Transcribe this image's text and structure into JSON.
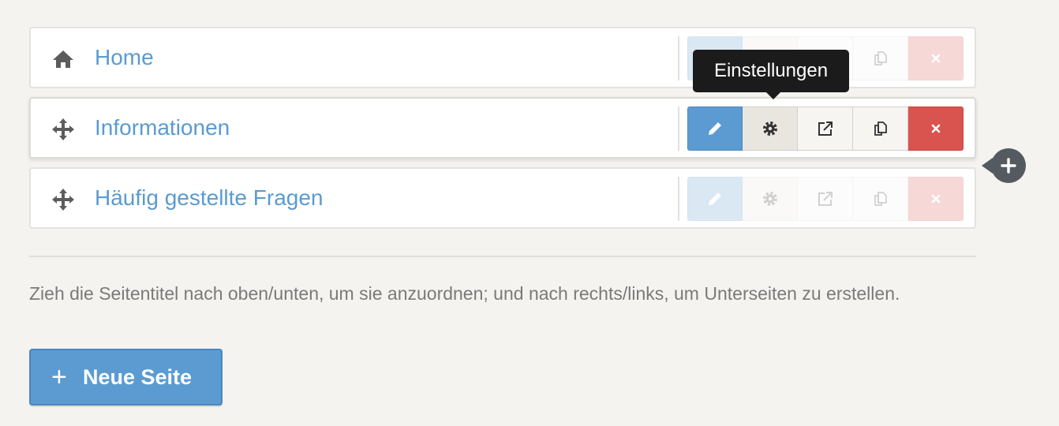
{
  "pages": [
    {
      "title": "Home",
      "icon": "home-icon",
      "actions_faded": true
    },
    {
      "title": "Informationen",
      "icon": "move-icon",
      "actions_faded": false
    },
    {
      "title": "Häufig gestellte Fragen",
      "icon": "move-icon",
      "actions_faded": true
    }
  ],
  "actions": [
    "pencil-icon",
    "gear-icon",
    "external-link-icon",
    "duplicate-icon",
    "close-icon"
  ],
  "tooltip": {
    "text": "Einstellungen"
  },
  "add_subpage": {
    "icon": "plus-icon"
  },
  "help_text": "Zieh die Seitentitel nach oben/unten, um sie anzuordnen; und nach rechts/links, um Unterseiten zu erstellen.",
  "new_page_button": {
    "plus": "+",
    "label": "Neue Seite"
  },
  "colors": {
    "accent": "#5b9bd1",
    "danger": "#d9534f",
    "title": "#5a9bd0",
    "background": "#f4f3f0"
  }
}
